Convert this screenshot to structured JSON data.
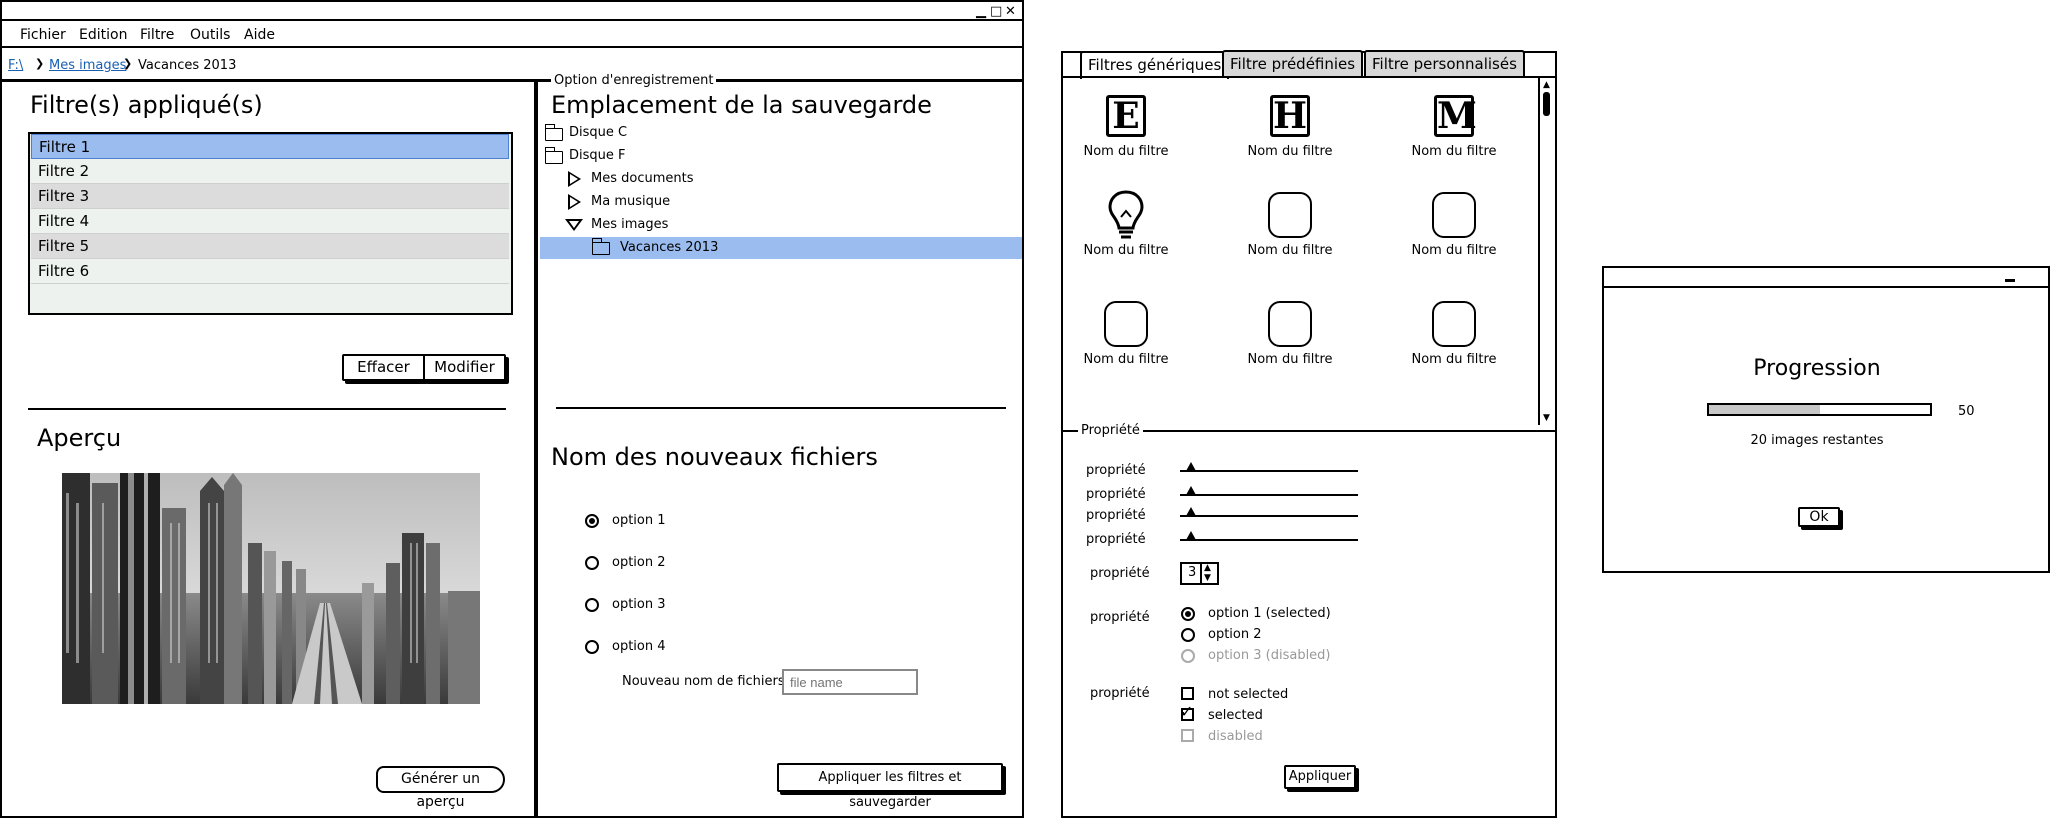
{
  "main_window": {
    "controls": {
      "minimize": "▁",
      "maximize": "□",
      "close": "✕"
    },
    "menu": [
      "Fichier",
      "Edition",
      "Filtre",
      "Outils",
      "Aide"
    ],
    "breadcrumb": {
      "drive": "F:\\",
      "folder": "Mes images",
      "current": "Vacances 2013"
    },
    "filters_panel": {
      "title": "Filtre(s) appliqué(s)",
      "items": [
        "Filtre 1",
        "Filtre 2",
        "Filtre 3",
        "Filtre 4",
        "Filtre 5",
        "Filtre 6"
      ],
      "selected_index": 0,
      "clear_button": "Effacer",
      "edit_button": "Modifier"
    },
    "preview": {
      "title": "Aperçu",
      "generate_button": "Générer un aperçu"
    },
    "save_options": {
      "group_label": "Option d'enregistrement",
      "location_title": "Emplacement de la sauvegarde",
      "tree": {
        "drive_c": "Disque C",
        "drive_f": "Disque F",
        "documents": "Mes documents",
        "music": "Ma musique",
        "images": "Mes images",
        "vacations": "Vacances 2013"
      },
      "filenames_title": "Nom des nouveaux fichiers",
      "options": [
        "option 1",
        "option 2",
        "option 3",
        "option 4"
      ],
      "selected_option": 0,
      "new_name_label": "Nouveau nom de fichiers",
      "new_name_placeholder": "file name",
      "apply_button": "Appliquer les filtres et sauvegarder"
    }
  },
  "filters_window": {
    "tabs": [
      "Filtres génériques",
      "Filtre prédéfinies",
      "Filtre personnalisés"
    ],
    "active_tab": 0,
    "grid_label": "Nom du filtre",
    "grid_icons": [
      "E",
      "H",
      "M",
      "lightbulb",
      "",
      "",
      "",
      "",
      ""
    ],
    "properties": {
      "group_label": "Propriété",
      "slider_label": "propriété",
      "slider_values": [
        0.08,
        0.08,
        0.08,
        0.08
      ],
      "stepper_label": "propriété",
      "stepper_value": "3",
      "radio_label": "propriété",
      "radio_options": [
        "option 1 (selected)",
        "option 2",
        "option 3 (disabled)"
      ],
      "checkbox_label": "propriété",
      "checkbox_options": [
        "not selected",
        "selected",
        "disabled"
      ],
      "apply_button": "Appliquer"
    }
  },
  "progress_dialog": {
    "title": "Progression",
    "value": 50,
    "value_label": "50",
    "remaining": "20 images restantes",
    "ok_button": "Ok"
  }
}
